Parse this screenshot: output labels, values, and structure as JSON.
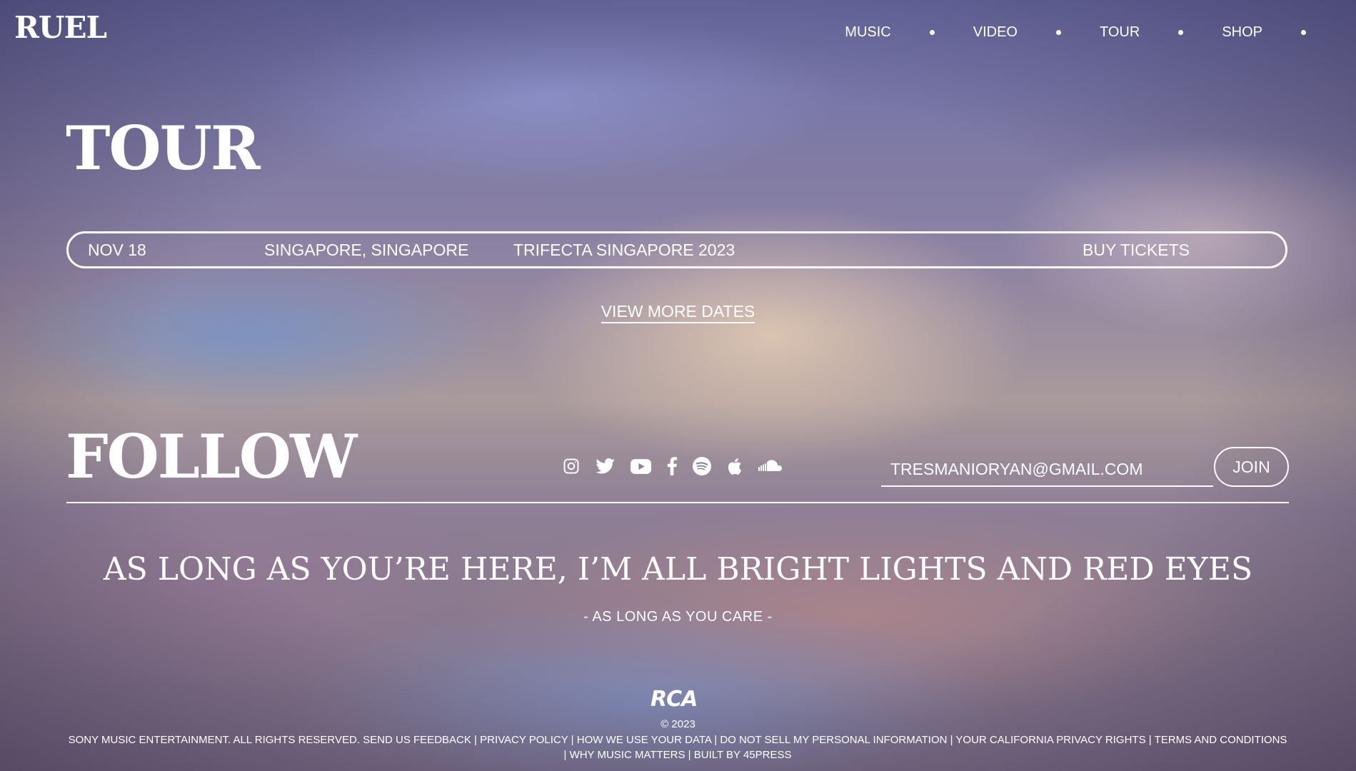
{
  "header": {
    "logo": "RUEL",
    "nav": [
      {
        "label": "MUSIC"
      },
      {
        "label": "VIDEO"
      },
      {
        "label": "TOUR"
      },
      {
        "label": "SHOP"
      }
    ]
  },
  "tour": {
    "title": "TOUR",
    "events": [
      {
        "date": "NOV 18",
        "location": "SINGAPORE, SINGAPORE",
        "event": "TRIFECTA SINGAPORE 2023",
        "cta": "BUY TICKETS"
      }
    ],
    "view_more": "VIEW MORE DATES"
  },
  "follow": {
    "title": "FOLLOW",
    "socials": [
      "instagram-icon",
      "twitter-icon",
      "youtube-icon",
      "facebook-icon",
      "spotify-icon",
      "apple-icon",
      "soundcloud-icon"
    ],
    "email_value": "TRESMANIORYAN@GMAIL.COM",
    "join_label": "JOIN"
  },
  "quote": {
    "text": "AS LONG AS YOU’RE HERE, I’M ALL BRIGHT LIGHTS AND RED EYES",
    "source": "- AS LONG AS YOU CARE -"
  },
  "footer": {
    "label_logo": "RCA",
    "copyright": "© 2023",
    "legal_prefix": "SONY MUSIC ENTERTAINMENT. ALL RIGHTS RESERVED.",
    "links": [
      "SEND US FEEDBACK",
      "PRIVACY POLICY",
      "HOW WE USE YOUR DATA",
      "DO NOT SELL MY PERSONAL INFORMATION",
      "YOUR CALIFORNIA PRIVACY RIGHTS",
      "TERMS AND CONDITIONS",
      "WHY MUSIC MATTERS",
      "BUILT BY 45PRESS"
    ]
  }
}
